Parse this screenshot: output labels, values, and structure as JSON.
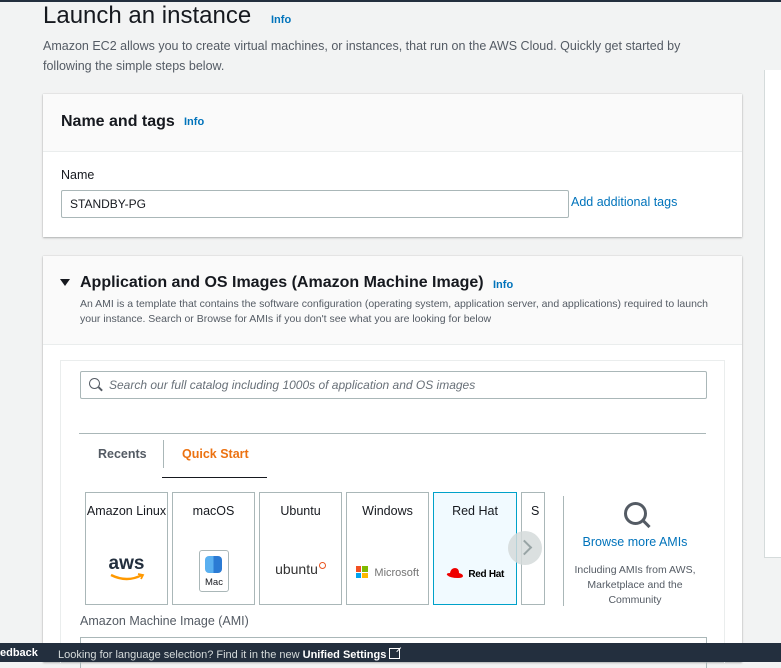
{
  "page": {
    "title": "Launch an instance",
    "info": "Info",
    "description": "Amazon EC2 allows you to create virtual machines, or instances, that run on the AWS Cloud. Quickly get started by following the simple steps below."
  },
  "name_tags": {
    "title": "Name and tags",
    "info": "Info",
    "name_label": "Name",
    "name_value": "STANDBY-PG",
    "add_tags": "Add additional tags"
  },
  "ami": {
    "title": "Application and OS Images (Amazon Machine Image)",
    "info": "Info",
    "description": "An AMI is a template that contains the software configuration (operating system, application server, and applications) required to launch your instance. Search or Browse for AMIs if you don't see what you are looking for below",
    "search_placeholder": "Search our full catalog including 1000s of application and OS images",
    "tabs": [
      "Recents",
      "Quick Start"
    ],
    "active_tab": "Quick Start",
    "cards": [
      {
        "label": "Amazon Linux",
        "logo": "aws"
      },
      {
        "label": "macOS",
        "logo": "Mac"
      },
      {
        "label": "Ubuntu",
        "logo": "ubuntu"
      },
      {
        "label": "Windows",
        "logo": "Microsoft"
      },
      {
        "label": "Red Hat",
        "logo": "Red Hat"
      },
      {
        "label": "S",
        "logo": ""
      }
    ],
    "selected_card": "Red Hat",
    "browse_link": "Browse more AMIs",
    "browse_sub": "Including AMIs from AWS, Marketplace and the Community",
    "ami_field_label": "Amazon Machine Image (AMI)"
  },
  "footer": {
    "feedback": "edback",
    "lang_text": "Looking for language selection? Find it in the new",
    "unified_settings": "Unified Settings"
  },
  "colors": {
    "link": "#0073bb",
    "active_tab": "#ec7211",
    "selected_border": "#00a1c9",
    "footer_bg": "#232f3e",
    "redhat_red": "#ee0000",
    "ubuntu_orange": "#e95420"
  }
}
